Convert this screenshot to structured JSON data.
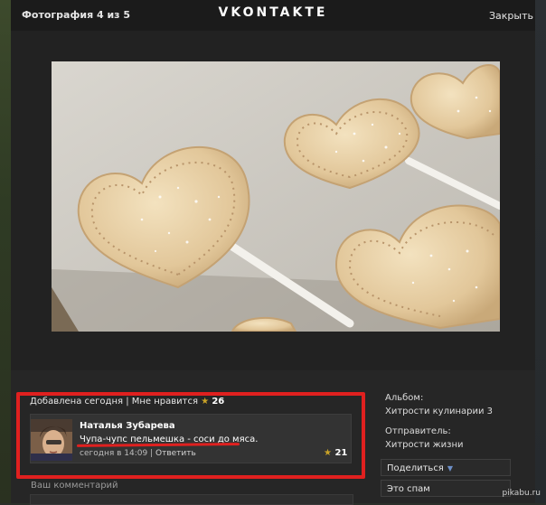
{
  "header": {
    "photo_counter": "Фотография 4 из 5",
    "logo": "VKONTAKTE",
    "close": "Закрыть"
  },
  "photo": {
    "icon": "photo-image"
  },
  "meta": {
    "added": "Добавлена сегодня",
    "separator": "|",
    "likes_label": "Мне нравится",
    "likes_count": "26"
  },
  "comment": {
    "author": "Наталья Зубарева",
    "text": "Чупа-чупс пельмешка - соси до мяса.",
    "time": "сегодня в 14:09",
    "separator": "|",
    "reply": "Ответить",
    "rating": "21"
  },
  "comment_form": {
    "label": "Ваш комментарий"
  },
  "sidebar": {
    "album_label": "Альбом:",
    "album_value": "Хитрости кулинарии 3",
    "sender_label": "Отправитель:",
    "sender_value": "Хитрости жизни",
    "share_button": "Поделиться",
    "spam_button": "Это спам"
  },
  "watermark": "pikabu.ru",
  "colors": {
    "highlight": "#e0201f",
    "star": "#c9a227",
    "link": "#6d8fc8"
  }
}
